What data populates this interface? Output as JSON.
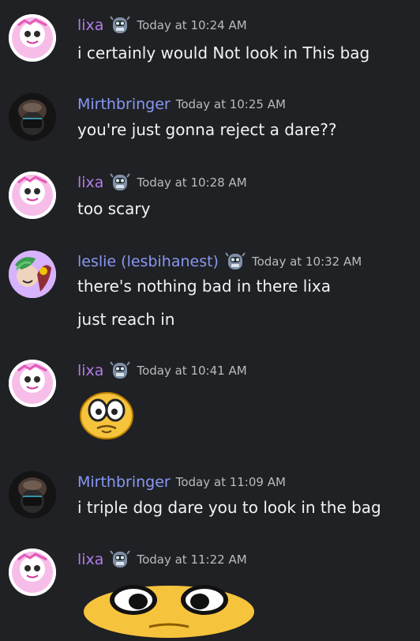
{
  "messages": [
    {
      "author": "lixa",
      "author_color": "#b27de8",
      "time": "Today at 10:24 AM",
      "lines": [
        "i certainly would Not look in This bag"
      ]
    },
    {
      "author": "Mirthbringer",
      "author_color": "#8898f5",
      "time": "Today at 10:25 AM",
      "lines": [
        "you're just gonna reject a dare??"
      ]
    },
    {
      "author": "lixa",
      "author_color": "#b27de8",
      "time": "Today at 10:28 AM",
      "lines": [
        "too scary"
      ]
    },
    {
      "author": "leslie (lesbihanest)",
      "author_color": "#8898f5",
      "time": "Today at 10:32 AM",
      "lines": [
        "there's nothing bad in there lixa",
        "just reach in"
      ]
    },
    {
      "author": "lixa",
      "author_color": "#b27de8",
      "time": "Today at 10:41 AM",
      "lines": []
    },
    {
      "author": "Mirthbringer",
      "author_color": "#8898f5",
      "time": "Today at 11:09 AM",
      "lines": [
        "i triple dog dare you to look in the bag"
      ]
    },
    {
      "author": "lixa",
      "author_color": "#b27de8",
      "time": "Today at 11:22 AM",
      "lines": []
    }
  ],
  "icons": {
    "badge": "robot-mask-badge-icon",
    "emoji_1": "worried-eyes-emoji",
    "emoji_2": "wide-eyes-emoji"
  },
  "theme": {
    "background": "#202124",
    "text": "#f2f3f5",
    "timestamp": "#b9bbbe"
  }
}
